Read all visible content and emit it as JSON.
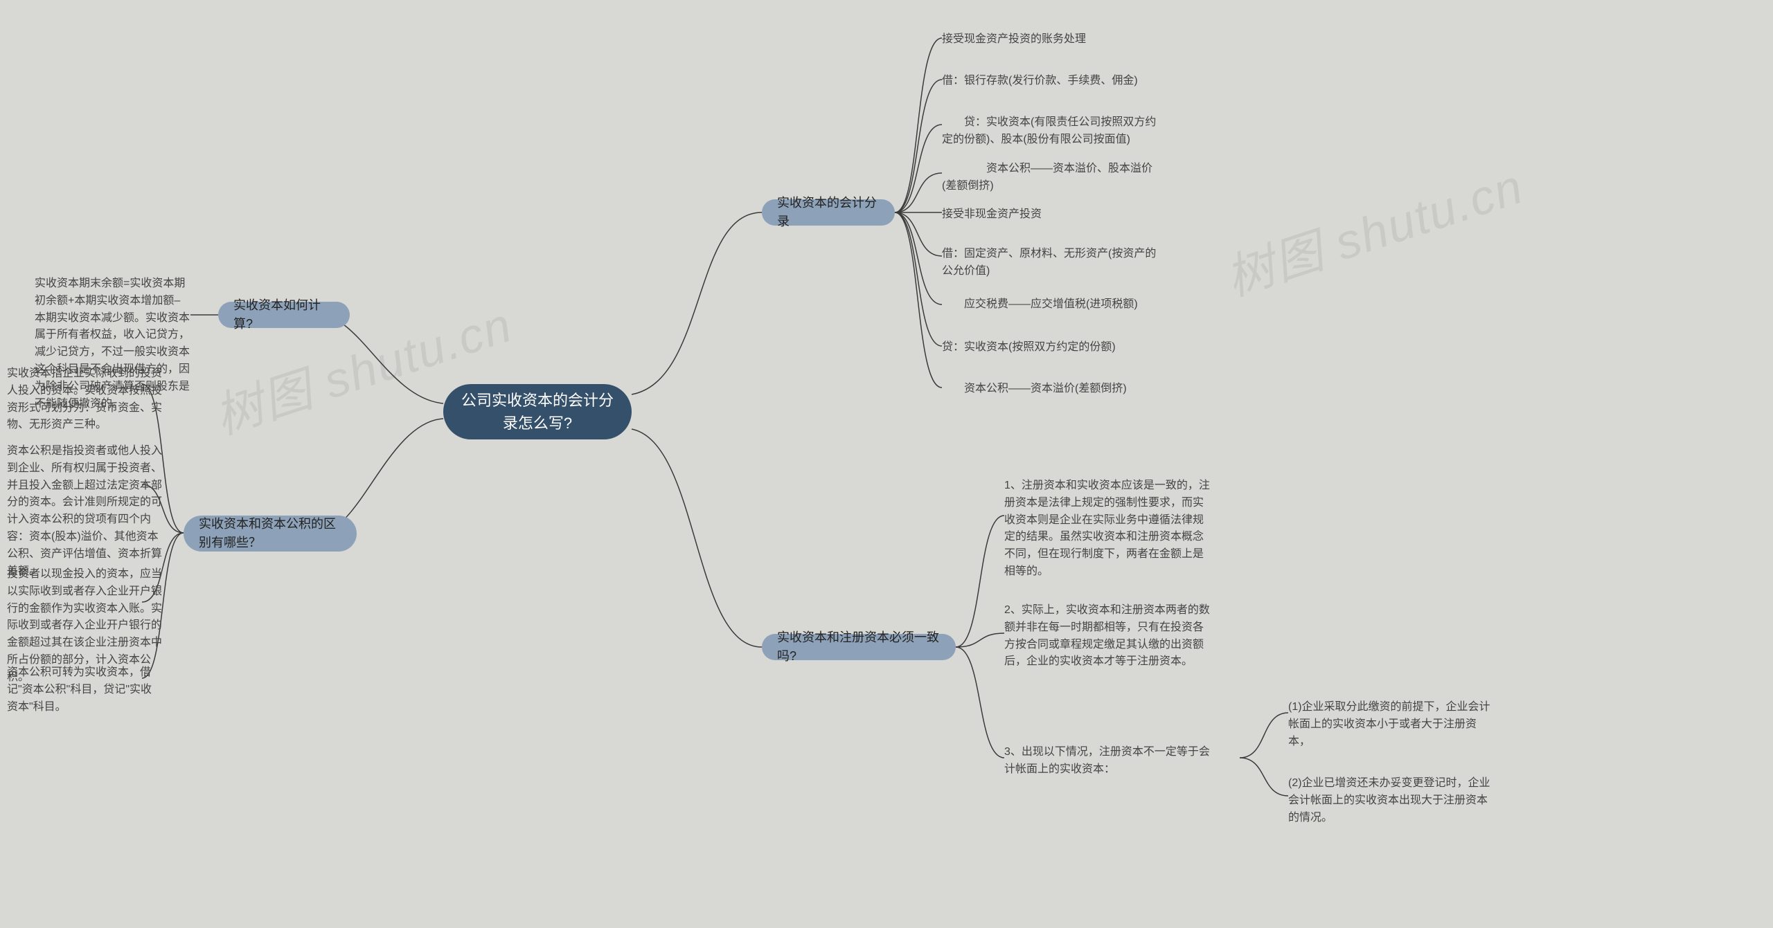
{
  "root": {
    "title": "公司实收资本的会计分录怎么写?"
  },
  "branches": {
    "calc": {
      "label": "实收资本如何计算?"
    },
    "diff": {
      "label": "实收资本和资本公积的区别有哪些？"
    },
    "entry": {
      "label": "实收资本的会计分录"
    },
    "consistent": {
      "label": "实收资本和注册资本必须一致吗?"
    }
  },
  "calc_leaf": {
    "text": "实收资本期末余额=实收资本期初余额+本期实收资本增加额–本期实收资本减少额。实收资本属于所有者权益，收入记贷方，减少记贷方，不过一般实收资本这个科目是不会出现借方的，因为除非公司破产清算否则股东是不能随便撤资的。"
  },
  "diff_leaves": {
    "d1": {
      "text": "实收资本指企业实际收到的投资人投入的资本。实收资本按照投资形式可划分为：货币资金、实物、无形资产三种。"
    },
    "d2": {
      "text": "资本公积是指投资者或他人投入到企业、所有权归属于投资者、并且投入金额上超过法定资本部分的资本。会计准则所规定的可计入资本公积的贷项有四个内容：资本(股本)溢价、其他资本公积、资产评估增值、资本折算差额。"
    },
    "d3": {
      "text": "投资者以现金投入的资本，应当以实际收到或者存入企业开户银行的金额作为实收资本入账。实际收到或者存入企业开户银行的金额超过其在该企业注册资本中所占份额的部分，计入资本公积。"
    },
    "d4": {
      "text": "资本公积可转为实收资本，借记\"资本公积\"科目，贷记\"实收资本\"科目。"
    }
  },
  "entry_leaves": {
    "e1": {
      "text": "接受现金资产投资的账务处理"
    },
    "e2": {
      "text": "借：银行存款(发行价款、手续费、佣金)"
    },
    "e3": {
      "text": "　　贷：实收资本(有限责任公司按照双方约定的份额)、股本(股份有限公司按面值)"
    },
    "e4": {
      "text": "　　　　资本公积——资本溢价、股本溢价(差额倒挤)"
    },
    "e5": {
      "text": "接受非现金资产投资"
    },
    "e6": {
      "text": "借：固定资产、原材料、无形资产(按资产的公允价值)"
    },
    "e7": {
      "text": "　　应交税费——应交增值税(进项税额)"
    },
    "e8": {
      "text": "贷：实收资本(按照双方约定的份额)"
    },
    "e9": {
      "text": "　　资本公积——资本溢价(差额倒挤)"
    }
  },
  "consistent_leaves": {
    "c1": {
      "text": "1、注册资本和实收资本应该是一致的，注册资本是法律上规定的强制性要求，而实收资本则是企业在实际业务中遵循法律规定的结果。虽然实收资本和注册资本概念不同，但在现行制度下，两者在金额上是相等的。"
    },
    "c2": {
      "text": "2、实际上，实收资本和注册资本两者的数额并非在每一时期都相等，只有在投资各方按合同或章程规定缴足其认缴的出资额后，企业的实收资本才等于注册资本。"
    },
    "c3": {
      "text": "3、出现以下情况，注册资本不一定等于会计帐面上的实收资本："
    }
  },
  "consistent_sub": {
    "s1": {
      "text": "(1)企业采取分此缴资的前提下，企业会计帐面上的实收资本小于或者大于注册资本，"
    },
    "s2": {
      "text": "(2)企业已增资还未办妥变更登记时，企业会计帐面上的实收资本出现大于注册资本的情况。"
    }
  },
  "watermarks": {
    "w1": "树图 shutu.cn",
    "w2": "树图 shutu.cn"
  }
}
